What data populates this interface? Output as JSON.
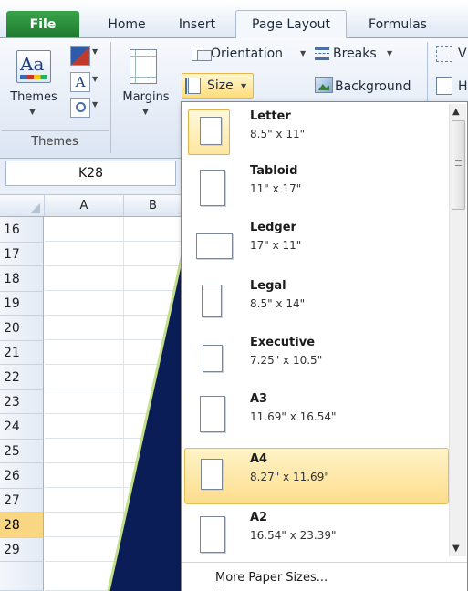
{
  "tabs": {
    "file": "File",
    "home": "Home",
    "insert": "Insert",
    "page_layout": "Page Layout",
    "formulas": "Formulas"
  },
  "ribbon": {
    "themes_label": "Themes",
    "themes_group_label": "Themes",
    "margins_label": "Margins",
    "orientation_label": "Orientation",
    "breaks_label": "Breaks",
    "size_label": "Size",
    "background_label": "Background",
    "clipped_right_1": "V",
    "clipped_right_2": "H"
  },
  "name_box": {
    "value": "K28"
  },
  "grid": {
    "columns": [
      "A",
      "B"
    ],
    "rows": [
      "16",
      "17",
      "18",
      "19",
      "20",
      "21",
      "22",
      "23",
      "24",
      "25",
      "26",
      "27",
      "28",
      "29"
    ],
    "active_row": "28"
  },
  "size_menu": {
    "items": [
      {
        "name": "Letter",
        "dims": "8.5\" x 11\""
      },
      {
        "name": "Tabloid",
        "dims": "11\" x 17\""
      },
      {
        "name": "Ledger",
        "dims": "17\" x 11\""
      },
      {
        "name": "Legal",
        "dims": "8.5\" x 14\""
      },
      {
        "name": "Executive",
        "dims": "7.25\" x 10.5\""
      },
      {
        "name": "A3",
        "dims": "11.69\" x 16.54\""
      },
      {
        "name": "A4",
        "dims": "8.27\" x 11.69\""
      },
      {
        "name": "A2",
        "dims": "16.54\" x 23.39\""
      }
    ],
    "selected_item": "A4",
    "more_label": "More Paper Sizes..."
  },
  "colors": {
    "file_tab": "#1e7a2e",
    "highlight": "#fddd8c",
    "chart_fill": "#0b1d56"
  }
}
